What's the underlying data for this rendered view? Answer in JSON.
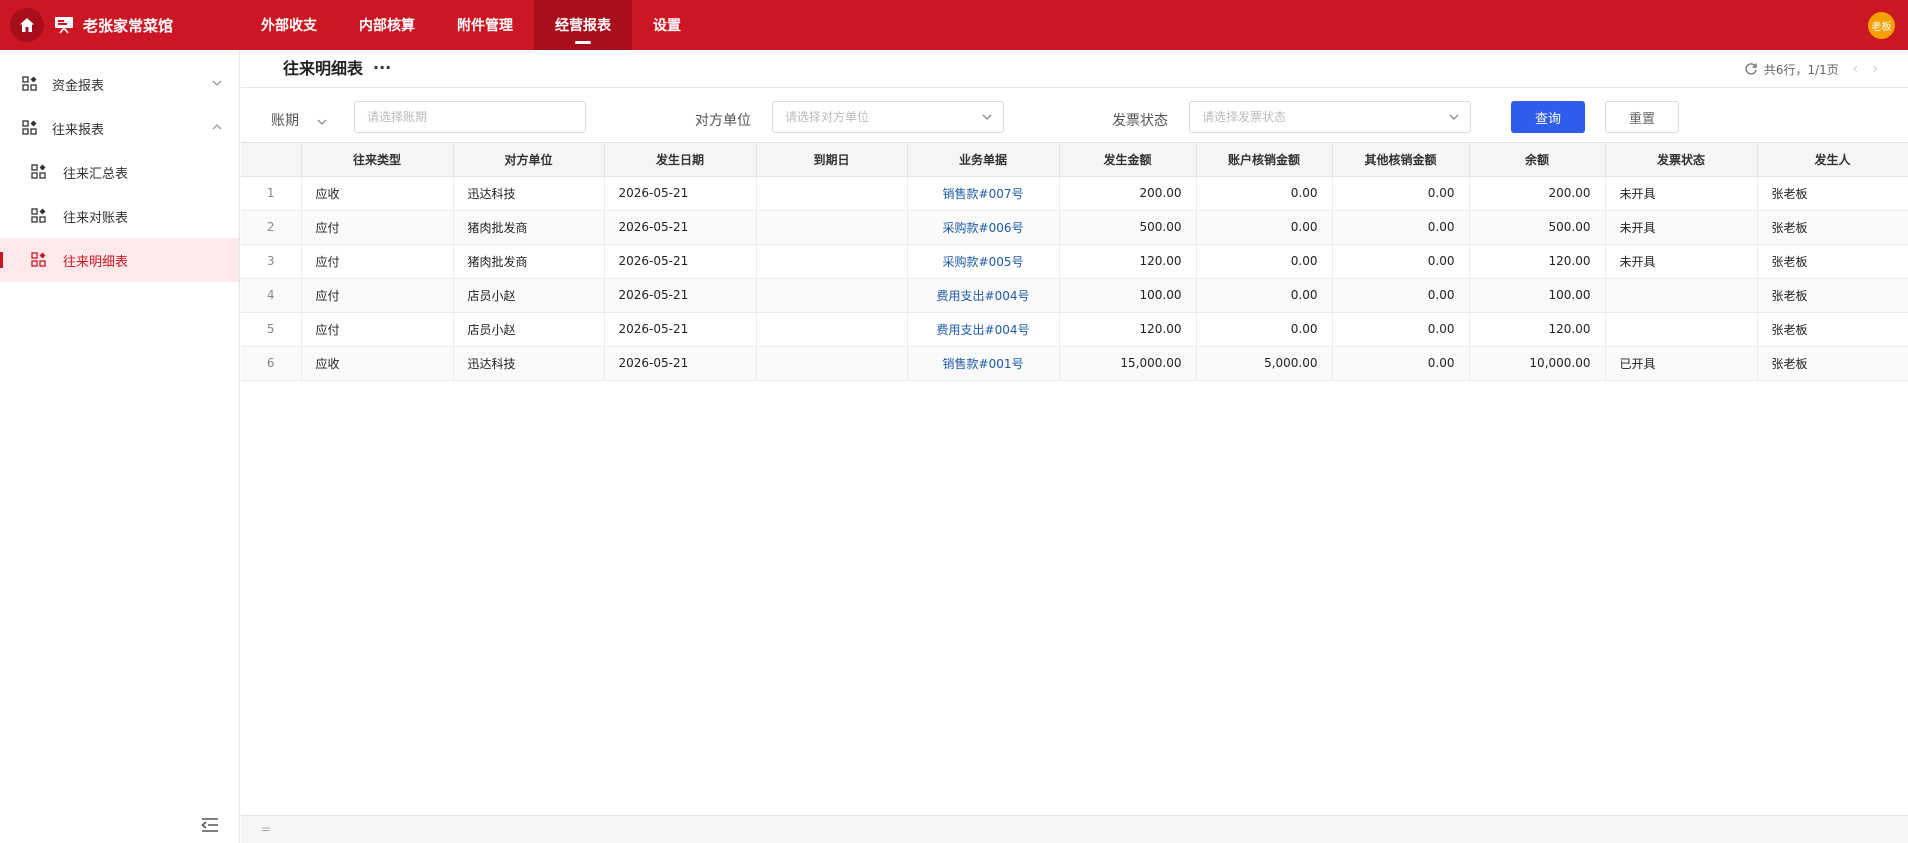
{
  "app": {
    "title": "老张家常菜馆",
    "avatar_text": "老板"
  },
  "nav": [
    {
      "label": "外部收支",
      "active": false
    },
    {
      "label": "内部核算",
      "active": false
    },
    {
      "label": "附件管理",
      "active": false
    },
    {
      "label": "经营报表",
      "active": true
    },
    {
      "label": "设置",
      "active": false
    }
  ],
  "sidebar": {
    "groups": [
      {
        "label": "资金报表",
        "expanded": false
      },
      {
        "label": "往来报表",
        "expanded": true
      }
    ],
    "sub_items": [
      {
        "label": "往来汇总表",
        "active": false
      },
      {
        "label": "往来对账表",
        "active": false
      },
      {
        "label": "往来明细表",
        "active": true
      }
    ]
  },
  "page": {
    "title": "往来明细表",
    "more": "···",
    "pager_text": "共6行，1/1页"
  },
  "filters": {
    "period_label": "账期",
    "period_placeholder": "请选择账期",
    "party_label": "对方单位",
    "party_placeholder": "请选择对方单位",
    "invoice_label": "发票状态",
    "invoice_placeholder": "请选择发票状态",
    "query_label": "查询",
    "reset_label": "重置"
  },
  "table": {
    "columns": [
      "往来类型",
      "对方单位",
      "发生日期",
      "到期日",
      "业务单据",
      "发生金额",
      "账户核销金额",
      "其他核销金额",
      "余额",
      "发票状态",
      "发生人"
    ],
    "rows": [
      {
        "idx": "1",
        "type": "应收",
        "party": "迅达科技",
        "date": "2026-05-21",
        "due": "",
        "doc": "销售款#007号",
        "amount": "200.00",
        "acct": "0.00",
        "other": "0.00",
        "balance": "200.00",
        "invoice": "未开具",
        "person": "张老板"
      },
      {
        "idx": "2",
        "type": "应付",
        "party": "猪肉批发商",
        "date": "2026-05-21",
        "due": "",
        "doc": "采购款#006号",
        "amount": "500.00",
        "acct": "0.00",
        "other": "0.00",
        "balance": "500.00",
        "invoice": "未开具",
        "person": "张老板"
      },
      {
        "idx": "3",
        "type": "应付",
        "party": "猪肉批发商",
        "date": "2026-05-21",
        "due": "",
        "doc": "采购款#005号",
        "amount": "120.00",
        "acct": "0.00",
        "other": "0.00",
        "balance": "120.00",
        "invoice": "未开具",
        "person": "张老板"
      },
      {
        "idx": "4",
        "type": "应付",
        "party": "店员小赵",
        "date": "2026-05-21",
        "due": "",
        "doc": "费用支出#004号",
        "amount": "100.00",
        "acct": "0.00",
        "other": "0.00",
        "balance": "100.00",
        "invoice": "",
        "person": "张老板"
      },
      {
        "idx": "5",
        "type": "应付",
        "party": "店员小赵",
        "date": "2026-05-21",
        "due": "",
        "doc": "费用支出#004号",
        "amount": "120.00",
        "acct": "0.00",
        "other": "0.00",
        "balance": "120.00",
        "invoice": "",
        "person": "张老板"
      },
      {
        "idx": "6",
        "type": "应收",
        "party": "迅达科技",
        "date": "2026-05-21",
        "due": "",
        "doc": "销售款#001号",
        "amount": "15,000.00",
        "acct": "5,000.00",
        "other": "0.00",
        "balance": "10,000.00",
        "invoice": "已开具",
        "person": "张老板"
      }
    ],
    "footer_symbol": "="
  },
  "colors": {
    "brand": "#cc1624",
    "brand_dark": "#a80f1b",
    "primary": "#2f5ce9",
    "avatar": "#f5a000",
    "link": "#1d5aa8"
  }
}
